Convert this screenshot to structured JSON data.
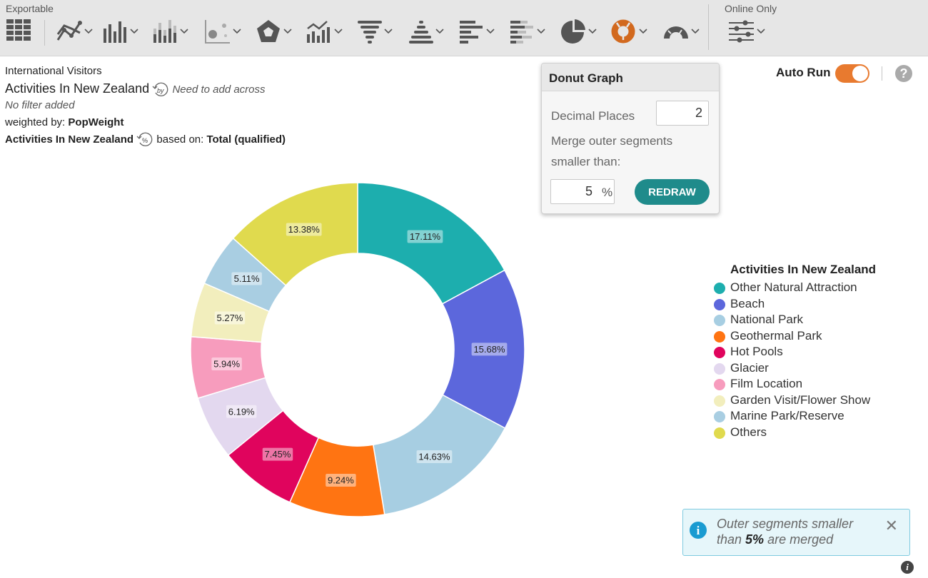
{
  "toolbar": {
    "exportable_label": "Exportable",
    "online_only_label": "Online Only",
    "icons": [
      "table-icon",
      "line-chart-icon",
      "bar-chart-icon",
      "stacked-bar-chart-icon",
      "scatter-chart-icon",
      "radar-chart-icon",
      "combo-chart-icon",
      "funnel-chart-icon",
      "pyramid-chart-icon",
      "horizontal-bar-chart-icon",
      "stacked-horizontal-bar-chart-icon",
      "pie-chart-icon",
      "donut-chart-icon",
      "gauge-chart-icon",
      "settings-sliders-icon"
    ],
    "active_icon": "donut-chart-icon",
    "active_color": "#d2691e"
  },
  "info": {
    "source": "International Visitors",
    "table_title": "Activities In New Zealand",
    "across_note": "Need to add across",
    "filter_note": "No filter added",
    "weighted_label": "weighted by:",
    "weighted_value": "PopWeight",
    "percent_variable": "Activities In New Zealand",
    "based_on_label": "based on:",
    "based_on_value": "Total (qualified)"
  },
  "popup": {
    "title": "Donut Graph",
    "decimal_label": "Decimal Places",
    "decimal_value": "2",
    "merge_label_line1": "Merge outer segments",
    "merge_label_line2": "smaller than:",
    "merge_value": "5",
    "merge_unit": "%",
    "redraw_label": "REDRAW"
  },
  "autorun": {
    "label": "Auto Run",
    "enabled": true,
    "help_symbol": "?"
  },
  "toast": {
    "text_before": "Outer segments smaller than ",
    "bold": "5%",
    "text_after": " are merged",
    "close_symbol": "✕"
  },
  "chart_data": {
    "type": "pie",
    "donut": true,
    "title": "",
    "legend_title": "Activities In New Zealand",
    "legend_position": "right",
    "categories": [
      "Other Natural Attraction",
      "Beach",
      "National Park",
      "Geothermal Park",
      "Hot Pools",
      "Glacier",
      "Film Location",
      "Garden Visit/Flower Show",
      "Marine Park/Reserve",
      "Others"
    ],
    "values": [
      17.11,
      15.68,
      14.63,
      9.24,
      7.45,
      6.19,
      5.94,
      5.27,
      5.11,
      13.38
    ],
    "labels": [
      "17.11%",
      "15.68%",
      "14.63%",
      "9.24%",
      "7.45%",
      "6.19%",
      "5.94%",
      "5.27%",
      "5.11%",
      "13.38%"
    ],
    "colors": [
      "#1daeae",
      "#5c67dc",
      "#a7cee2",
      "#ff7412",
      "#e0045d",
      "#e3d8ef",
      "#f79cbd",
      "#f2eebd",
      "#a9cee2",
      "#e0da4e"
    ]
  }
}
